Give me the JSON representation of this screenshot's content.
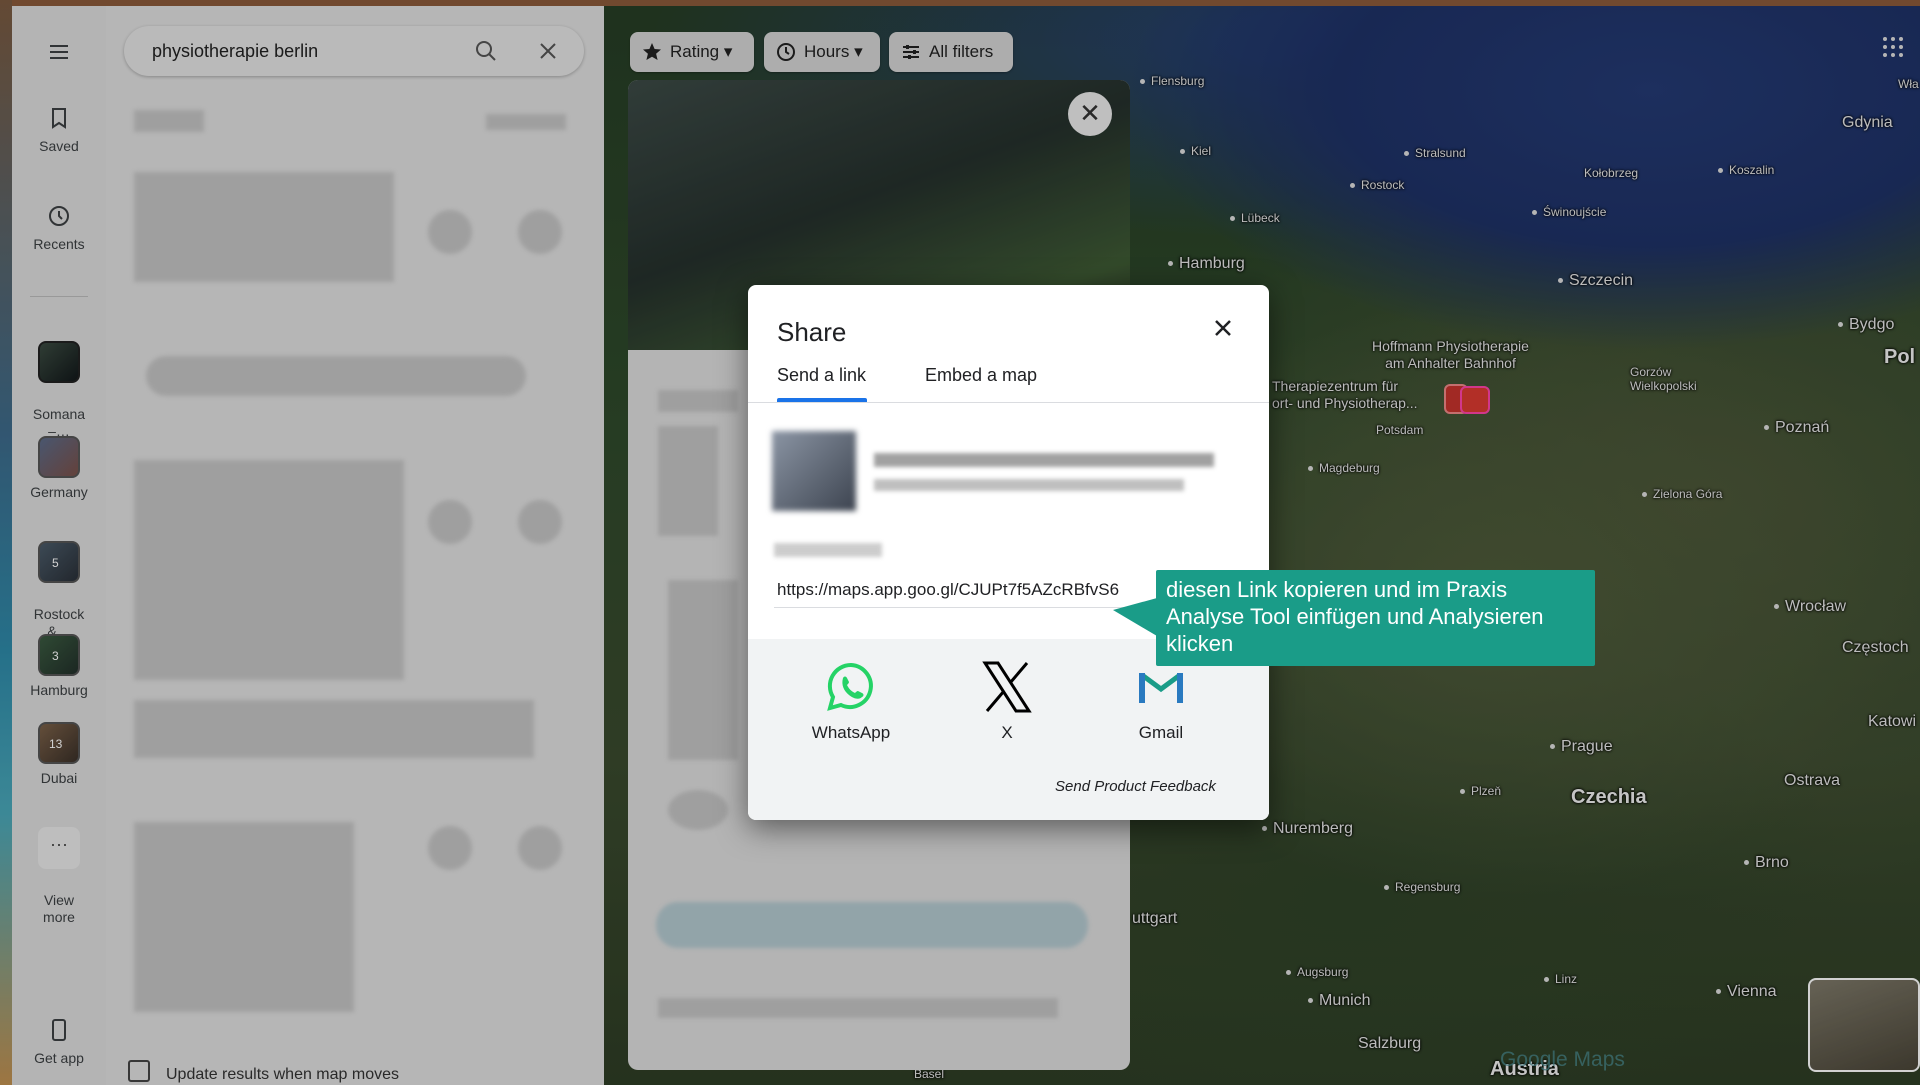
{
  "search": {
    "query": "physiotherapie berlin"
  },
  "rail": {
    "saved": "Saved",
    "recents": "Recents",
    "items": [
      {
        "label": "Somana\n–…",
        "badge": ""
      },
      {
        "label": "Germany",
        "badge": ""
      },
      {
        "label": "Rostock\n&…",
        "badge": "5"
      },
      {
        "label": "Hamburg",
        "badge": "3"
      },
      {
        "label": "Dubai",
        "badge": "13"
      }
    ],
    "view_more": "View\nmore",
    "get_app": "Get app"
  },
  "filters": {
    "rating": "Rating",
    "hours": "Hours",
    "all": "All filters"
  },
  "update_results": "Update results when map moves",
  "modal": {
    "title": "Share",
    "tabs": [
      "Send a link",
      "Embed a map"
    ],
    "url": "https://maps.app.goo.gl/CJUPt7f5AZcRBfvS6",
    "share_targets": [
      {
        "label": "WhatsApp",
        "icon": "whatsapp-icon",
        "color": "#25d366"
      },
      {
        "label": "X",
        "icon": "x-icon",
        "color": "#000000"
      },
      {
        "label": "Gmail",
        "icon": "gmail-icon",
        "color": "#1a9c88"
      }
    ],
    "feedback": "Send Product Feedback"
  },
  "tooltip": "diesen Link kopieren und im Praxis Analyse Tool einfügen und Analysieren klicken",
  "map": {
    "labels": [
      {
        "text": "Flensburg",
        "size": "sm"
      },
      {
        "text": "Kiel",
        "size": "sm"
      },
      {
        "text": "Stralsund",
        "size": "sm"
      },
      {
        "text": "Rostock",
        "size": "sm"
      },
      {
        "text": "Lübeck",
        "size": "sm"
      },
      {
        "text": "Hamburg",
        "size": "md"
      },
      {
        "text": "Szczecin",
        "size": "md"
      },
      {
        "text": "Kołobrzeg",
        "size": "sm"
      },
      {
        "text": "Koszalin",
        "size": "sm"
      },
      {
        "text": "Świnoujście",
        "size": "sm"
      },
      {
        "text": "Gdynia",
        "size": "md"
      },
      {
        "text": "Bydgo",
        "size": "md"
      },
      {
        "text": "Pol",
        "size": "lg"
      },
      {
        "text": "Gorzów\nWielkopolski",
        "size": "sm"
      },
      {
        "text": "Poznań",
        "size": "md"
      },
      {
        "text": "Potsdam",
        "size": "sm"
      },
      {
        "text": "Magdeburg",
        "size": "sm"
      },
      {
        "text": "Zielona Góra",
        "size": "sm"
      },
      {
        "text": "Wrocław",
        "size": "md"
      },
      {
        "text": "Częstoch",
        "size": "md"
      },
      {
        "text": "Katowi",
        "size": "md"
      },
      {
        "text": "Prague",
        "size": "md"
      },
      {
        "text": "Plzeň",
        "size": "sm"
      },
      {
        "text": "Czechia",
        "size": "lg"
      },
      {
        "text": "Ostrava",
        "size": "md"
      },
      {
        "text": "Nuremberg",
        "size": "md"
      },
      {
        "text": "Brno",
        "size": "md"
      },
      {
        "text": "Regensburg",
        "size": "sm"
      },
      {
        "text": "uttgart",
        "size": "md"
      },
      {
        "text": "Augsburg",
        "size": "sm"
      },
      {
        "text": "Linz",
        "size": "sm"
      },
      {
        "text": "Munich",
        "size": "md"
      },
      {
        "text": "Vienna",
        "size": "md"
      },
      {
        "text": "Salzburg",
        "size": "md"
      },
      {
        "text": "Austria",
        "size": "lg"
      },
      {
        "text": "Basel",
        "size": "sm"
      },
      {
        "text": "Wła",
        "size": "sm"
      }
    ],
    "pins": [
      {
        "text": "Hoffmann Physiotherapie\nam Anhalter Bahnhof"
      },
      {
        "text": "Therapiezentrum für\nort- und Physiotherap..."
      }
    ],
    "attribution": "Google Maps"
  }
}
